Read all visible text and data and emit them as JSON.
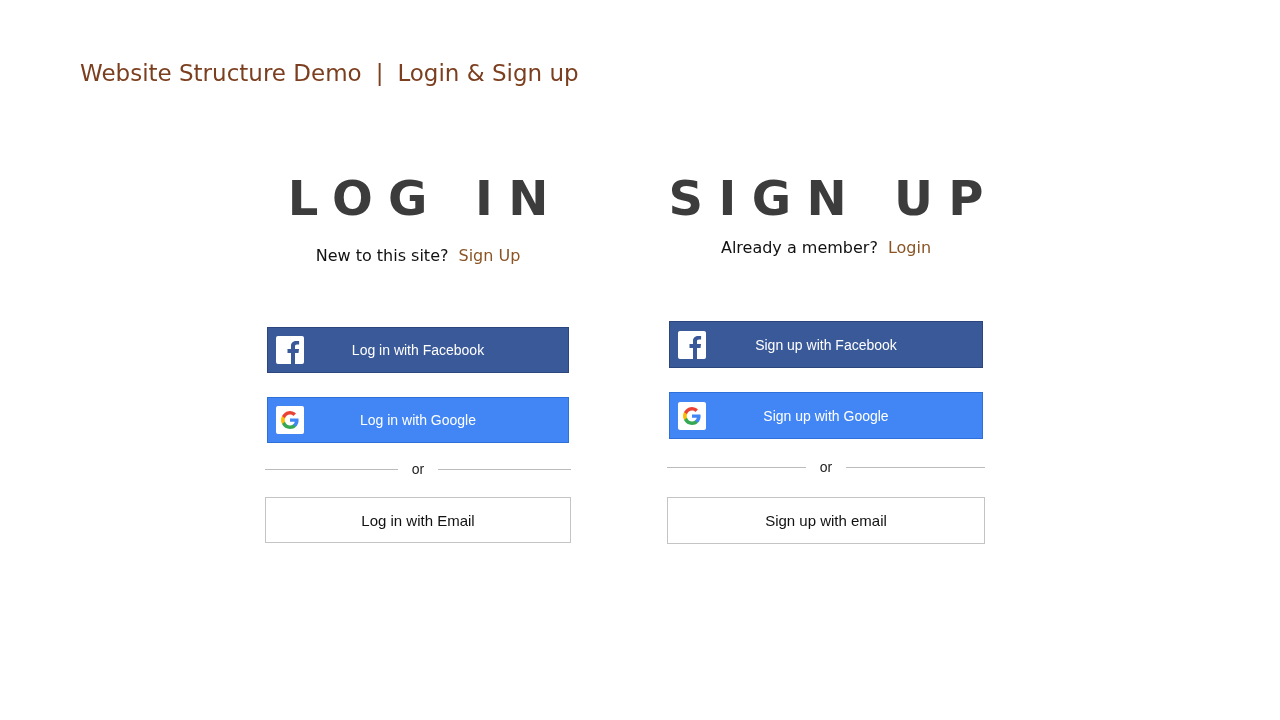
{
  "header": {
    "title": "Website Structure Demo",
    "separator": "|",
    "subtitle": "Login & Sign up"
  },
  "panels": [
    {
      "heading": "LOG IN",
      "prompt": "New to this site?",
      "link": "Sign Up",
      "buttons": [
        {
          "kind": "facebook",
          "label": "Log in with Facebook"
        },
        {
          "kind": "google",
          "label": "Log in with Google"
        }
      ],
      "divider": "or",
      "email_button": "Log in with Email"
    },
    {
      "heading": "SIGN UP",
      "prompt": "Already a member?",
      "link": "Login",
      "buttons": [
        {
          "kind": "facebook",
          "label": "Sign up with Facebook"
        },
        {
          "kind": "google",
          "label": "Sign up with Google"
        }
      ],
      "divider": "or",
      "email_button": "Sign up with email"
    }
  ]
}
